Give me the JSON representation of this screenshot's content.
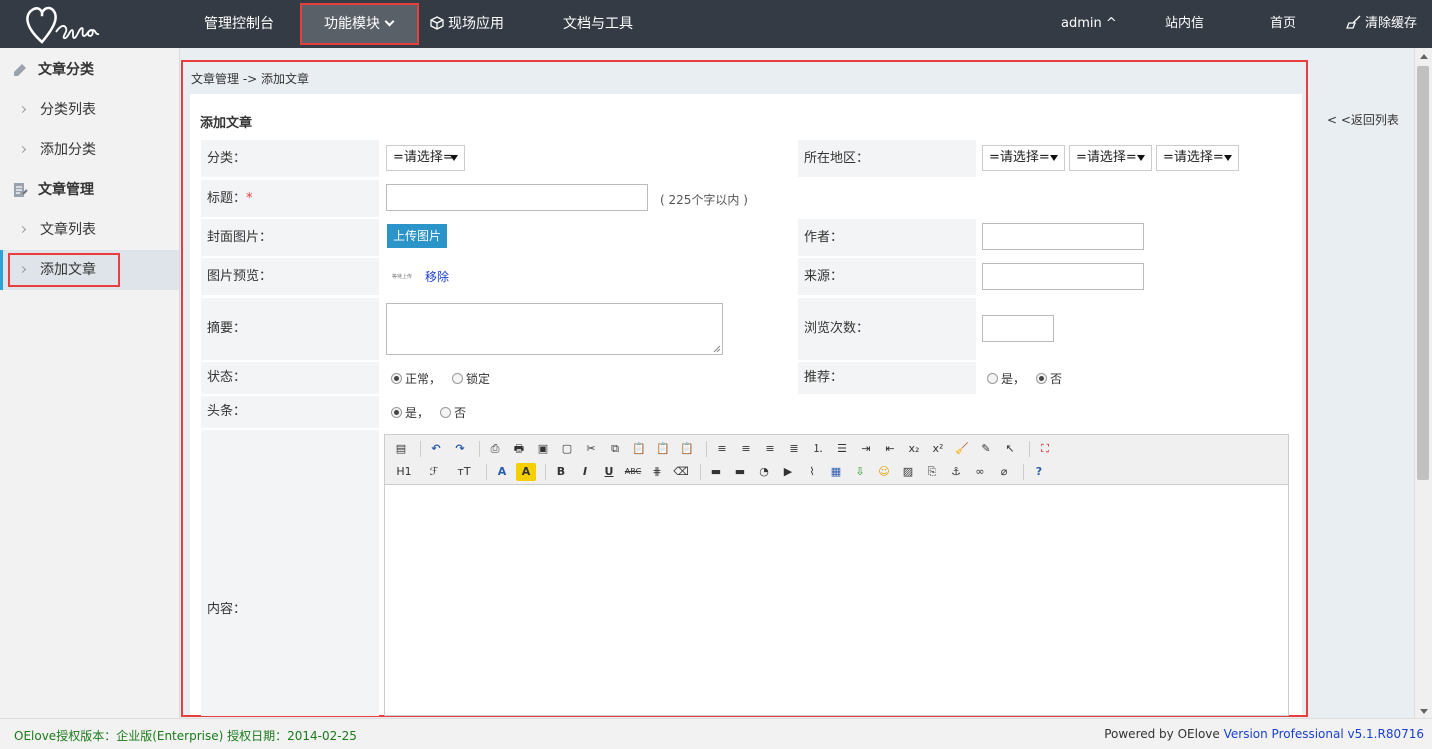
{
  "header": {
    "nav": [
      {
        "label": "管理控制台"
      },
      {
        "label": "功能模块"
      },
      {
        "label": "现场应用"
      },
      {
        "label": "文档与工具"
      }
    ],
    "user": "admin ^",
    "messages": "站内信",
    "home": "首页",
    "clear_cache": "清除缓存"
  },
  "sidebar": {
    "group1": "文章分类",
    "group1_items": [
      "分类列表",
      "添加分类"
    ],
    "group2": "文章管理",
    "group2_items": [
      "文章列表",
      "添加文章"
    ]
  },
  "main": {
    "breadcrumb": "文章管理 -> 添加文章",
    "title": "添加文章",
    "back": "< <返回列表",
    "fields": {
      "category_label": "分类：",
      "category_value": "=请选择=",
      "region_label": "所在地区：",
      "region_values": [
        "=请选择=",
        "=请选择=",
        "=请选择="
      ],
      "title_label": "标题：",
      "title_required": "*",
      "title_hint": "( 225个字以内 )",
      "cover_label": "封面图片：",
      "upload_btn": "上传图片",
      "author_label": "作者：",
      "preview_label": "图片预览：",
      "preview_thumb": "等待上传",
      "remove": "移除",
      "source_label": "来源：",
      "summary_label": "摘要：",
      "views_label": "浏览次数：",
      "status_label": "状态：",
      "status_normal": "正常，",
      "status_locked": "锁定",
      "recommend_label": "推荐：",
      "recommend_yes": "是，",
      "recommend_no": "否",
      "headline_label": "头条：",
      "headline_yes": "是，",
      "headline_no": "否",
      "content_label": "内容："
    },
    "editor": {
      "h1": "H1",
      "font": "ℱ",
      "size": "тT",
      "color": "A",
      "bold": "B",
      "italic": "I",
      "underline": "U",
      "strike": "ABC"
    }
  },
  "footer": {
    "license": "OElove授权版本：企业版(Enterprise) 授权日期：2014-02-25",
    "powered": "Powered by OElove",
    "version": "Version Professional v5.1.R80716"
  }
}
